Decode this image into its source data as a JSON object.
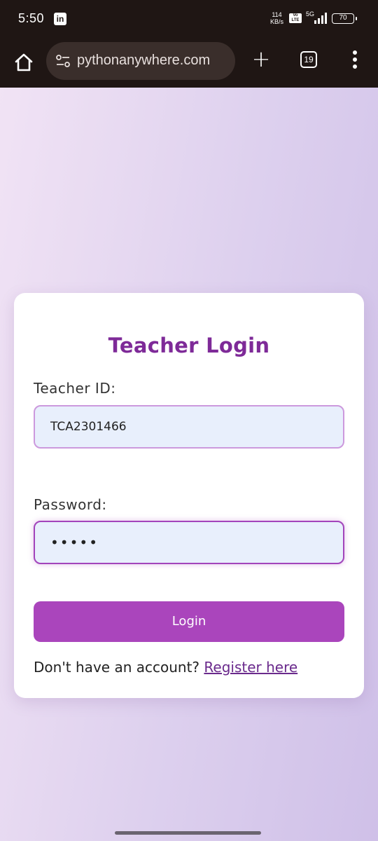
{
  "status_bar": {
    "time": "5:50",
    "notification_app": "in",
    "net_speed_value": "114",
    "net_speed_unit": "KB/s",
    "volte_top": "Vo",
    "volte_bottom": "LTE",
    "network": "5G",
    "battery": "70"
  },
  "browser": {
    "url": "pythonanywhere.com",
    "new_tab_symbol": "+",
    "tab_count": "19"
  },
  "login": {
    "title": "Teacher Login",
    "teacher_id_label": "Teacher ID:",
    "teacher_id_value": "TCA2301466",
    "password_label": "Password:",
    "password_value": "•••••",
    "login_button": "Login",
    "register_prompt": "Don't have an account? ",
    "register_link": "Register here"
  },
  "colors": {
    "accent": "#aa45bc",
    "title": "#7e2a98",
    "link": "#6a2a8c",
    "chrome": "#1f1614"
  }
}
